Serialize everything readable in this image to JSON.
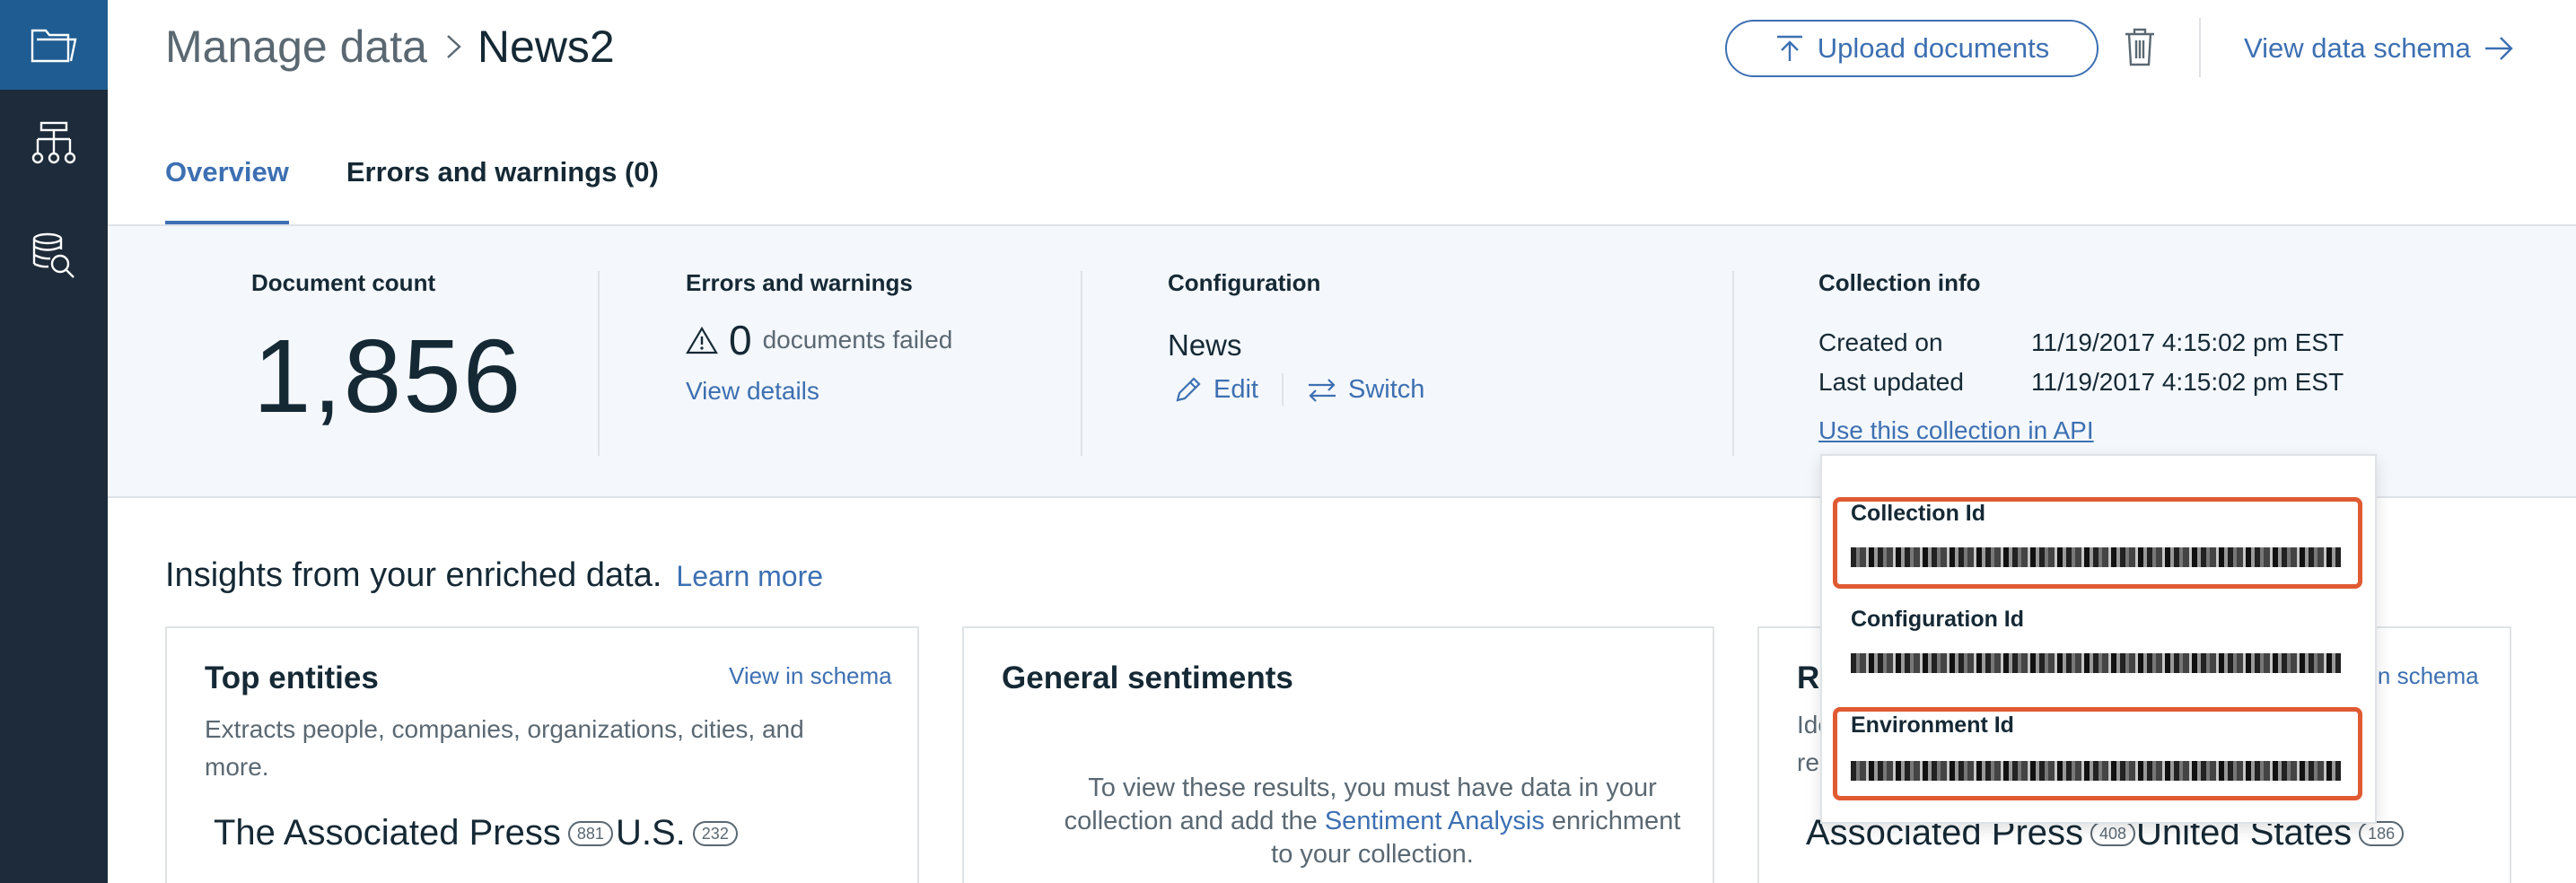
{
  "header": {
    "breadcrumb_root": "Manage data",
    "breadcrumb_current": "News2",
    "upload_label": "Upload documents",
    "schema_label": "View data schema"
  },
  "tabs": [
    {
      "label": "Overview",
      "active": true
    },
    {
      "label": "Errors and warnings (0)",
      "active": false
    }
  ],
  "stats": {
    "document_count": {
      "label": "Document count",
      "value": "1,856"
    },
    "errors": {
      "label": "Errors and warnings",
      "count": "0",
      "text": "documents failed",
      "link": "View details"
    },
    "configuration": {
      "label": "Configuration",
      "name": "News",
      "edit": "Edit",
      "switch": "Switch"
    },
    "collection_info": {
      "label": "Collection info",
      "created_label": "Created on",
      "created_value": "11/19/2017 4:15:02 pm EST",
      "updated_label": "Last updated",
      "updated_value": "11/19/2017 4:15:02 pm EST",
      "api_link": "Use this collection in API"
    }
  },
  "api_popover": {
    "collection_id_label": "Collection Id",
    "configuration_id_label": "Configuration Id",
    "environment_id_label": "Environment Id",
    "highlight_color": "#e05a32"
  },
  "insights": {
    "title": "Insights from your enriched data.",
    "learn_more": "Learn more"
  },
  "cards": {
    "top_entities": {
      "title": "Top entities",
      "link": "View in schema",
      "description": "Extracts people, companies, organizations, cities, and more.",
      "entities": [
        {
          "name": "The Associated Press",
          "count": "881"
        },
        {
          "name": "U.S.",
          "count": "232"
        }
      ]
    },
    "sentiments": {
      "title": "General sentiments",
      "message_before": "To view these results, you must have data in your collection and add the ",
      "message_link": "Sentiment Analysis",
      "message_after": " enrichment to your collection."
    },
    "third": {
      "title_fragment": "R",
      "link": "View in schema",
      "desc_line1": "Ide",
      "desc_line2": "re",
      "entities": [
        {
          "name": "Associated Press",
          "count": "408"
        },
        {
          "name": "United States",
          "count": "186"
        }
      ]
    }
  },
  "colors": {
    "accent": "#3d70b2",
    "sidebar": "#1d2b3a",
    "sidebar_active": "#1f5c91",
    "band": "#f4f7fb"
  }
}
